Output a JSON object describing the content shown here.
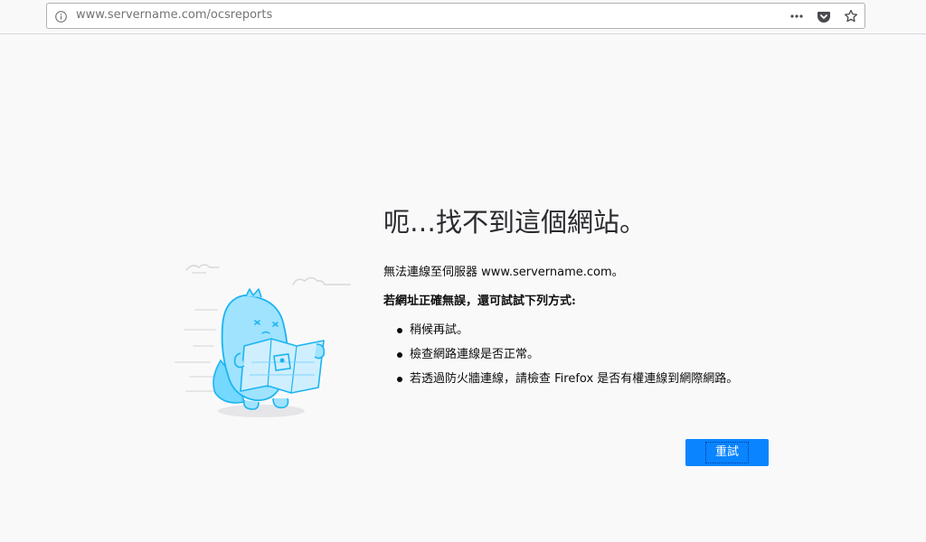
{
  "browser": {
    "url": "www.servername.com/ocsreports",
    "icons": [
      "info-icon",
      "more-icon",
      "pocket-icon",
      "bookmark-star-icon"
    ]
  },
  "error_page": {
    "title": "呃…找不到這個網站。",
    "description": "無法連線至伺服器 www.servername.com。",
    "suggestion_heading": "若網址正確無誤，還可試試下列方式:",
    "suggestions": [
      "稍候再試。",
      "檢查網路連線是否正常。",
      "若透過防火牆連線，請檢查 Firefox 是否有權連線到網際網路。"
    ],
    "retry_label": "重試"
  },
  "colors": {
    "page_bg": "#f9f9fa",
    "accent": "#0a84ff",
    "illustration": "#58d1ff",
    "text": "#0c0c0d"
  }
}
